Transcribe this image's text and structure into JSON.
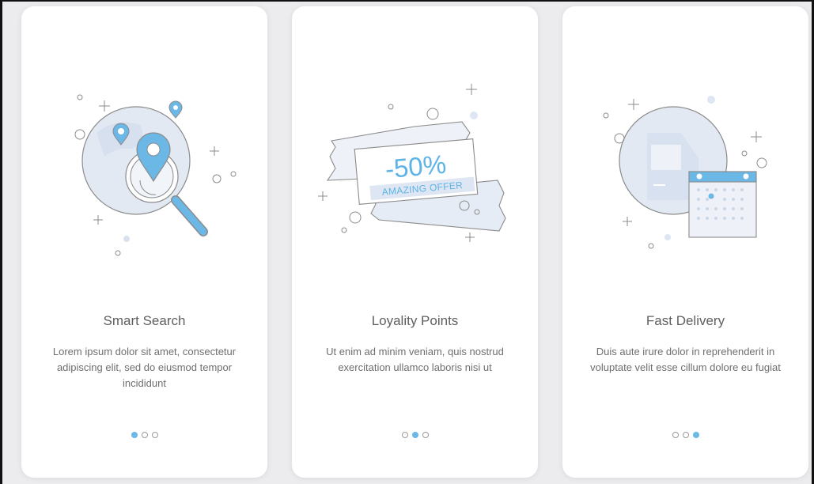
{
  "cards": [
    {
      "title": "Smart Search",
      "description": "Lorem ipsum dolor sit amet, consectetur adipiscing elit, sed do eiusmod tempor incididunt",
      "illustration": "map-search-icon",
      "active_dot": 0
    },
    {
      "title": "Loyality Points",
      "description": "Ut enim ad minim veniam, quis nostrud exercitation ullamco laboris nisi ut",
      "illustration": "coupon-icon",
      "offer_percent": "-50%",
      "offer_text": "AMAZING OFFER",
      "active_dot": 1
    },
    {
      "title": "Fast Delivery",
      "description": "Duis aute irure dolor in reprehenderit in voluptate velit esse cillum dolore eu fugiat",
      "illustration": "delivery-calendar-icon",
      "active_dot": 2
    }
  ],
  "pagination_count": 3,
  "colors": {
    "accent": "#6bb7e6",
    "illustration_fill": "#e3e9f3",
    "pin": "#6bb7e6",
    "text": "#5f5f5f"
  }
}
